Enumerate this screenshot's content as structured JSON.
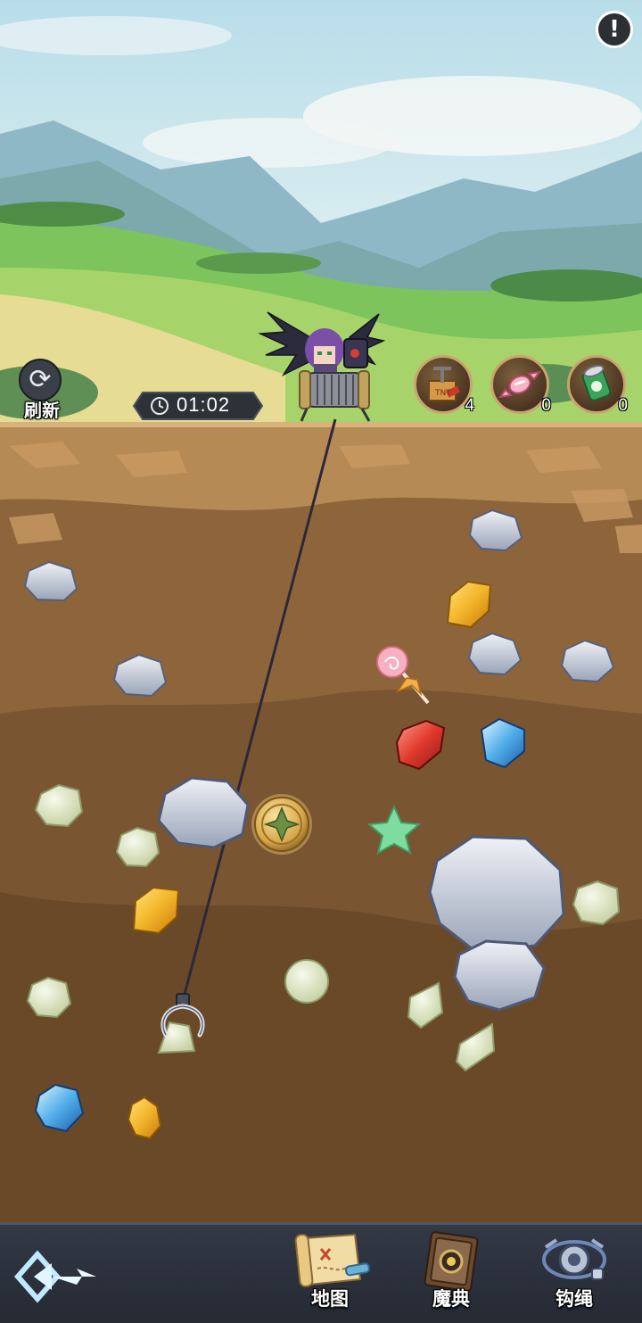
{
  "hud": {
    "refresh_label": "刷新",
    "timer": "01:02",
    "alert_symbol": "!"
  },
  "items": [
    {
      "name": "dynamite-icon",
      "icon_text": "TNT",
      "count": "4"
    },
    {
      "name": "candy-icon",
      "count": "0"
    },
    {
      "name": "potion-can-icon",
      "count": "0"
    }
  ],
  "nav": {
    "map_label": "地图",
    "codex_label": "魔典",
    "hook_rope_label": "钩绳"
  },
  "colors": {
    "sky": "#cfe7ef",
    "dirt_top": "#a67a48",
    "dirt_mid": "#8a6239",
    "dirt_deep": "#73502e",
    "bottom_bar": "#2b303b"
  }
}
